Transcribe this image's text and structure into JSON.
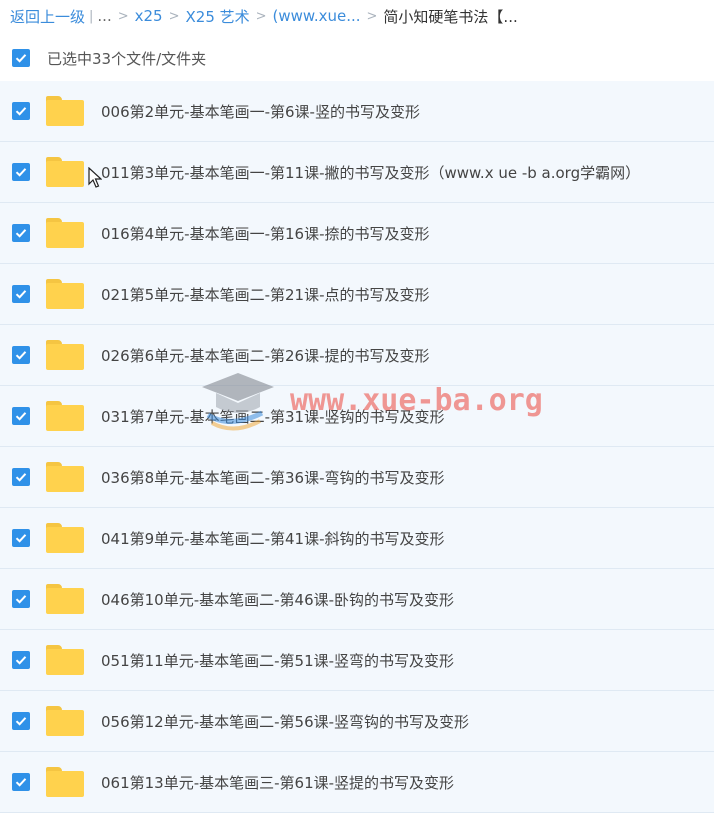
{
  "breadcrumb": {
    "back": "返回上一级",
    "ellipsis": "...",
    "sep": ">",
    "items": [
      "x25",
      "X25 艺术",
      "(www.xue..."
    ],
    "current": "简小知硬笔书法【..."
  },
  "selection": {
    "text": "已选中33个文件/文件夹"
  },
  "files": [
    "006第2单元-基本笔画一-第6课-竖的书写及变形",
    "011第3单元-基本笔画一-第11课-撇的书写及变形（www.x ue -b a.org学霸网）",
    "016第4单元-基本笔画一-第16课-捺的书写及变形",
    "021第5单元-基本笔画二-第21课-点的书写及变形",
    "026第6单元-基本笔画二-第26课-提的书写及变形",
    "031第7单元-基本笔画二-第31课-竖钩的书写及变形",
    "036第8单元-基本笔画二-第36课-弯钩的书写及变形",
    "041第9单元-基本笔画二-第41课-斜钩的书写及变形",
    "046第10单元-基本笔画二-第46课-卧钩的书写及变形",
    "051第11单元-基本笔画二-第51课-竖弯的书写及变形",
    "056第12单元-基本笔画二-第56课-竖弯钩的书写及变形",
    "061第13单元-基本笔画三-第61课-竖提的书写及变形"
  ],
  "watermark": {
    "text": "www.xue-ba.org"
  },
  "colors": {
    "link": "#3b8cdb",
    "checkbox": "#2f91e8",
    "row_bg": "#f3f8fd",
    "folder": "#ffd24d"
  }
}
